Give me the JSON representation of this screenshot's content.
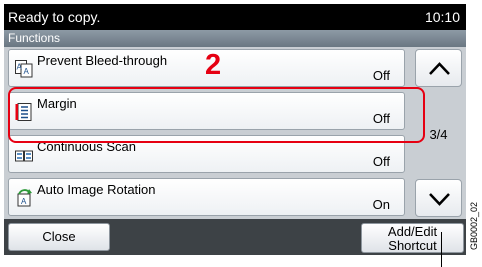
{
  "status": {
    "message": "Ready to copy.",
    "time": "10:10"
  },
  "header": {
    "title": "Functions"
  },
  "items": [
    {
      "label": "Prevent Bleed-through",
      "value": "Off",
      "icon": "prevent-bleed-icon"
    },
    {
      "label": "Margin",
      "value": "Off",
      "icon": "margin-icon"
    },
    {
      "label": "Continuous Scan",
      "value": "Off",
      "icon": "continuous-scan-icon"
    },
    {
      "label": "Auto Image Rotation",
      "value": "On",
      "icon": "auto-rotation-icon"
    }
  ],
  "annotation": {
    "step": "2",
    "highlight_color": "#e60012"
  },
  "pager": {
    "page": "3/4"
  },
  "footer": {
    "close_label": "Close",
    "add_edit_line1": "Add/Edit",
    "add_edit_line2": "Shortcut"
  },
  "figure_code": "GB0002_02"
}
